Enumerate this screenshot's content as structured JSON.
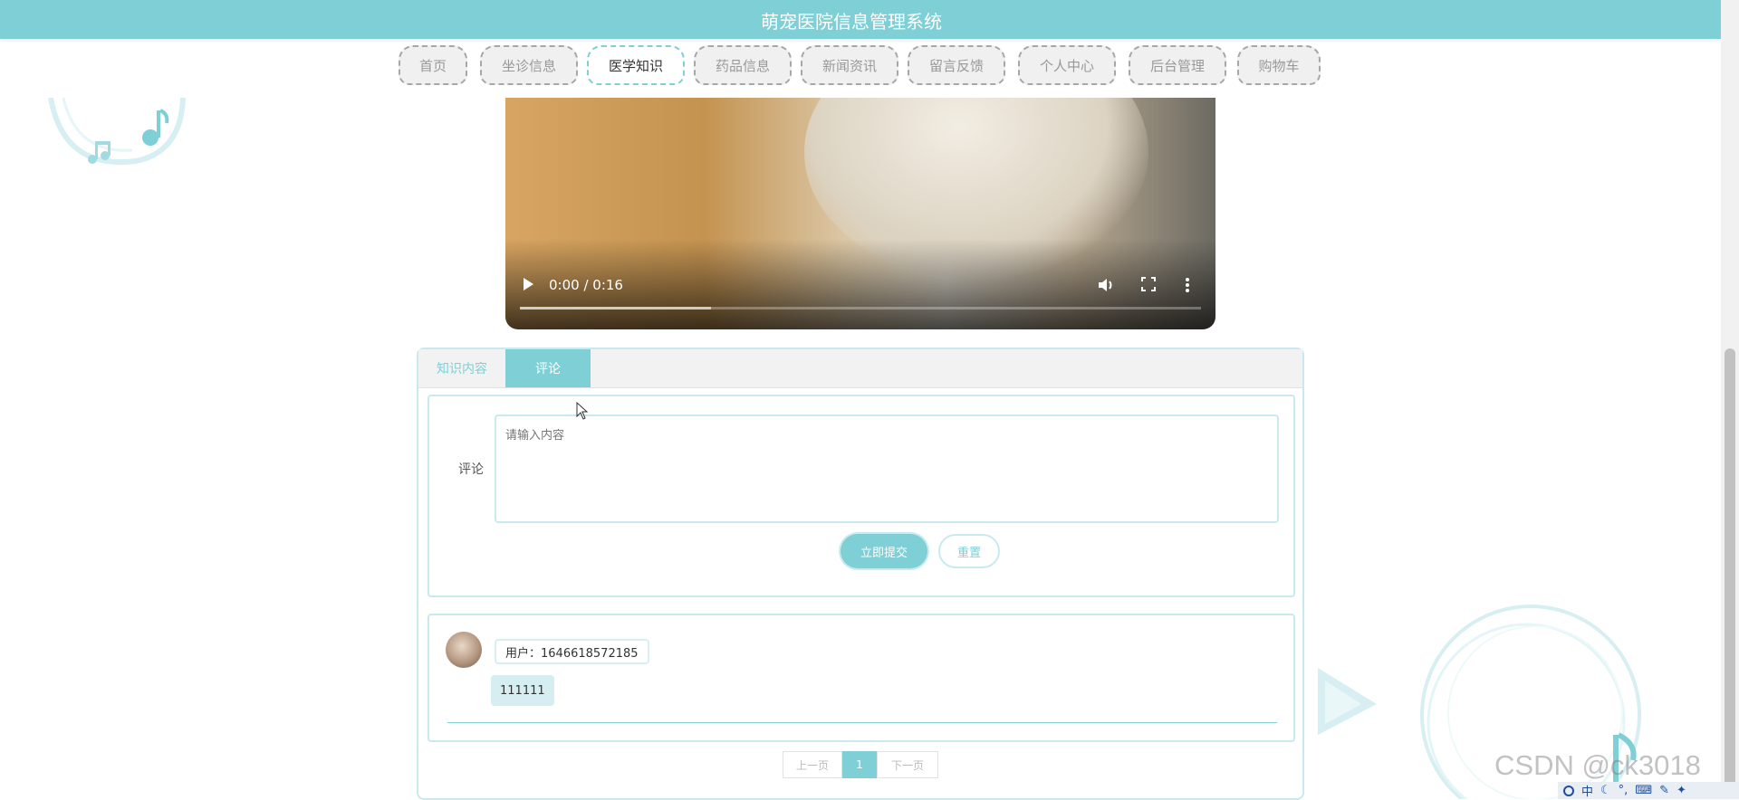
{
  "app": {
    "title": "萌宠医院信息管理系统"
  },
  "nav": {
    "items": [
      {
        "label": "首页",
        "active": false
      },
      {
        "label": "坐诊信息",
        "active": false
      },
      {
        "label": "医学知识",
        "active": true
      },
      {
        "label": "药品信息",
        "active": false
      },
      {
        "label": "新闻资讯",
        "active": false
      },
      {
        "label": "留言反馈",
        "active": false
      },
      {
        "label": "个人中心",
        "active": false
      },
      {
        "label": "后台管理",
        "active": false
      },
      {
        "label": "购物车",
        "active": false
      }
    ]
  },
  "video": {
    "time": "0:00 / 0:16",
    "progress": 0.28,
    "icons": [
      "play-icon",
      "volume-icon",
      "fullscreen-icon",
      "more-icon"
    ]
  },
  "tabs": [
    {
      "label": "知识内容",
      "active": false
    },
    {
      "label": "评论",
      "active": true
    }
  ],
  "comment_form": {
    "label": "评论",
    "placeholder": "请输入内容",
    "submit_label": "立即提交",
    "reset_label": "重置"
  },
  "comments": [
    {
      "user": "用户：1646618572185",
      "content": "111111"
    }
  ],
  "pagination": {
    "prev": "上一页",
    "current": "1",
    "next": "下一页"
  },
  "watermark": "CSDN @ck3018",
  "tray": {
    "ime": "中"
  },
  "colors": {
    "accent": "#7ecfd6",
    "border": "#c8eaee"
  }
}
